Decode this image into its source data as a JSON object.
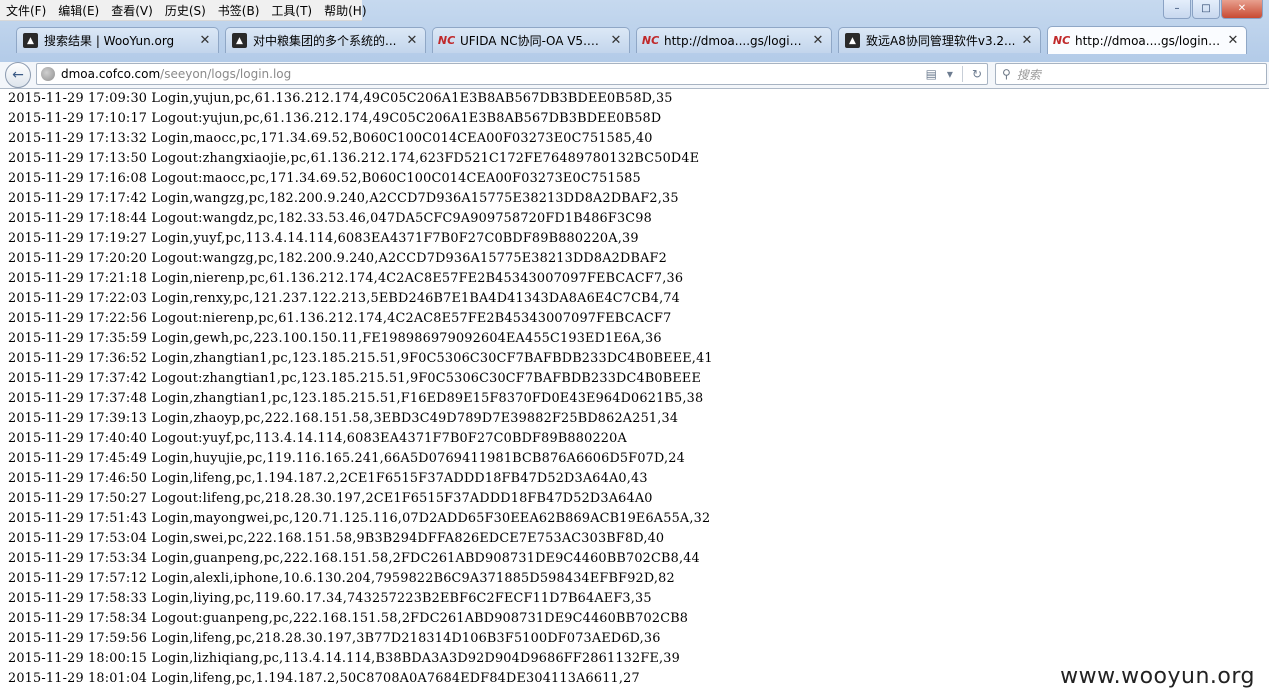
{
  "menu": [
    "文件(F)",
    "编辑(E)",
    "查看(V)",
    "历史(S)",
    "书签(B)",
    "工具(T)",
    "帮助(H)"
  ],
  "tabs": [
    {
      "title": "搜索结果 | WooYun.org",
      "icon": "wooyun-favicon"
    },
    {
      "title": "对中粮集团的多个系统的...",
      "icon": "wooyun-favicon"
    },
    {
      "title": "UFIDA NC协同-OA V5.72...",
      "icon": "seeyon-favicon"
    },
    {
      "title": "http://dmoa....gs/login.log",
      "icon": "seeyon-favicon"
    },
    {
      "title": "致远A8协同管理软件v3.2...",
      "icon": "wooyun-favicon"
    },
    {
      "title": "http://dmoa....gs/login.log",
      "icon": "seeyon-favicon",
      "active": true
    }
  ],
  "url": {
    "domain": "dmoa.cofco.com",
    "path": "/seeyon/logs/login.log"
  },
  "search": {
    "placeholder": "搜索"
  },
  "log_lines": [
    "2015-11-29 17:09:30 Login,yujun,pc,61.136.212.174,49C05C206A1E3B8AB567DB3BDEE0B58D,35",
    "2015-11-29 17:10:17 Logout:yujun,pc,61.136.212.174,49C05C206A1E3B8AB567DB3BDEE0B58D",
    "2015-11-29 17:13:32 Login,maocc,pc,171.34.69.52,B060C100C014CEA00F03273E0C751585,40",
    "2015-11-29 17:13:50 Logout:zhangxiaojie,pc,61.136.212.174,623FD521C172FE76489780132BC50D4E",
    "2015-11-29 17:16:08 Logout:maocc,pc,171.34.69.52,B060C100C014CEA00F03273E0C751585",
    "2015-11-29 17:17:42 Login,wangzg,pc,182.200.9.240,A2CCD7D936A15775E38213DD8A2DBAF2,35",
    "2015-11-29 17:18:44 Logout:wangdz,pc,182.33.53.46,047DA5CFC9A909758720FD1B486F3C98",
    "2015-11-29 17:19:27 Login,yuyf,pc,113.4.14.114,6083EA4371F7B0F27C0BDF89B880220A,39",
    "2015-11-29 17:20:20 Logout:wangzg,pc,182.200.9.240,A2CCD7D936A15775E38213DD8A2DBAF2",
    "2015-11-29 17:21:18 Login,nierenp,pc,61.136.212.174,4C2AC8E57FE2B45343007097FEBCACF7,36",
    "2015-11-29 17:22:03 Login,renxy,pc,121.237.122.213,5EBD246B7E1BA4D41343DA8A6E4C7CB4,74",
    "2015-11-29 17:22:56 Logout:nierenp,pc,61.136.212.174,4C2AC8E57FE2B45343007097FEBCACF7",
    "2015-11-29 17:35:59 Login,gewh,pc,223.100.150.11,FE198986979092604EA455C193ED1E6A,36",
    "2015-11-29 17:36:52 Login,zhangtian1,pc,123.185.215.51,9F0C5306C30CF7BAFBDB233DC4B0BEEE,41",
    "2015-11-29 17:37:42 Logout:zhangtian1,pc,123.185.215.51,9F0C5306C30CF7BAFBDB233DC4B0BEEE",
    "2015-11-29 17:37:48 Login,zhangtian1,pc,123.185.215.51,F16ED89E15F8370FD0E43E964D0621B5,38",
    "2015-11-29 17:39:13 Login,zhaoyp,pc,222.168.151.58,3EBD3C49D789D7E39882F25BD862A251,34",
    "2015-11-29 17:40:40 Logout:yuyf,pc,113.4.14.114,6083EA4371F7B0F27C0BDF89B880220A",
    "2015-11-29 17:45:49 Login,huyujie,pc,119.116.165.241,66A5D0769411981BCB876A6606D5F07D,24",
    "2015-11-29 17:46:50 Login,lifeng,pc,1.194.187.2,2CE1F6515F37ADDD18FB47D52D3A64A0,43",
    "2015-11-29 17:50:27 Logout:lifeng,pc,218.28.30.197,2CE1F6515F37ADDD18FB47D52D3A64A0",
    "2015-11-29 17:51:43 Login,mayongwei,pc,120.71.125.116,07D2ADD65F30EEA62B869ACB19E6A55A,32",
    "2015-11-29 17:53:04 Login,swei,pc,222.168.151.58,9B3B294DFFA826EDCE7E753AC303BF8D,40",
    "2015-11-29 17:53:34 Login,guanpeng,pc,222.168.151.58,2FDC261ABD908731DE9C4460BB702CB8,44",
    "2015-11-29 17:57:12 Login,alexli,iphone,10.6.130.204,7959822B6C9A371885D598434EFBF92D,82",
    "2015-11-29 17:58:33 Login,liying,pc,119.60.17.34,743257223B2EBF6C2FECF11D7B64AEF3,35",
    "2015-11-29 17:58:34 Logout:guanpeng,pc,222.168.151.58,2FDC261ABD908731DE9C4460BB702CB8",
    "2015-11-29 17:59:56 Login,lifeng,pc,218.28.30.197,3B77D218314D106B3F5100DF073AED6D,36",
    "2015-11-29 18:00:15 Login,lizhiqiang,pc,113.4.14.114,B38BDA3A3D92D904D9686FF2861132FE,39",
    "2015-11-29 18:01:04 Login,lifeng,pc,1.194.187.2,50C8708A0A7684EDF84DE304113A6611,27"
  ],
  "watermark": "www.wooyun.org"
}
